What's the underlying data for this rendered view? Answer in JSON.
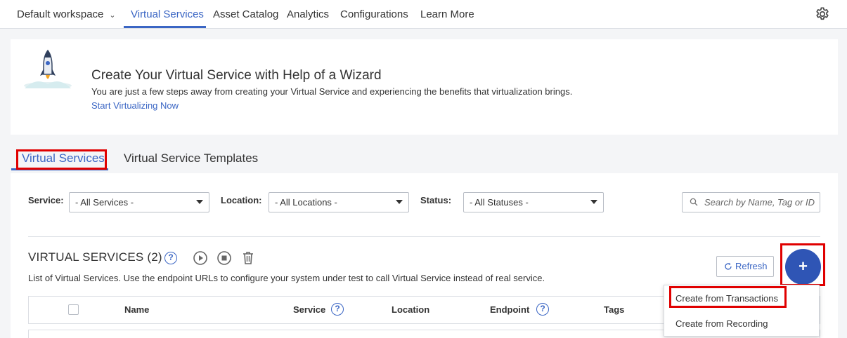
{
  "topnav": {
    "workspace": "Default workspace",
    "items": [
      {
        "label": "Virtual Services",
        "active": true
      },
      {
        "label": "Asset Catalog"
      },
      {
        "label": "Analytics"
      },
      {
        "label": "Configurations"
      },
      {
        "label": "Learn More"
      }
    ],
    "settings_icon": "gear-icon"
  },
  "banner": {
    "title": "Create Your Virtual Service with Help of a Wizard",
    "description": "You are just a few steps away from creating your Virtual Service and experiencing the benefits that virtualization brings.",
    "link": "Start Virtualizing Now",
    "icon": "rocket-icon"
  },
  "tabs": [
    {
      "label": "Virtual Services",
      "active": true
    },
    {
      "label": "Virtual Service Templates"
    }
  ],
  "filters": {
    "service": {
      "label": "Service:",
      "value": "- All Services -"
    },
    "location": {
      "label": "Location:",
      "value": "- All Locations -"
    },
    "status": {
      "label": "Status:",
      "value": "- All Statuses -"
    },
    "search_placeholder": "Search by Name, Tag or ID"
  },
  "section": {
    "title": "VIRTUAL SERVICES (2)",
    "description": "List of Virtual Services. Use the endpoint URLs to configure your system under test to call Virtual Service instead of real service.",
    "refresh_label": "Refresh",
    "add_label": "+"
  },
  "table": {
    "headers": [
      "Name",
      "Service",
      "Location",
      "Endpoint",
      "Tags"
    ]
  },
  "add_menu": {
    "items": [
      "Create from Transactions",
      "Create from Recording"
    ]
  },
  "colors": {
    "accent": "#3b66c4",
    "fab": "#2f55b5",
    "highlight": "#e00000"
  }
}
